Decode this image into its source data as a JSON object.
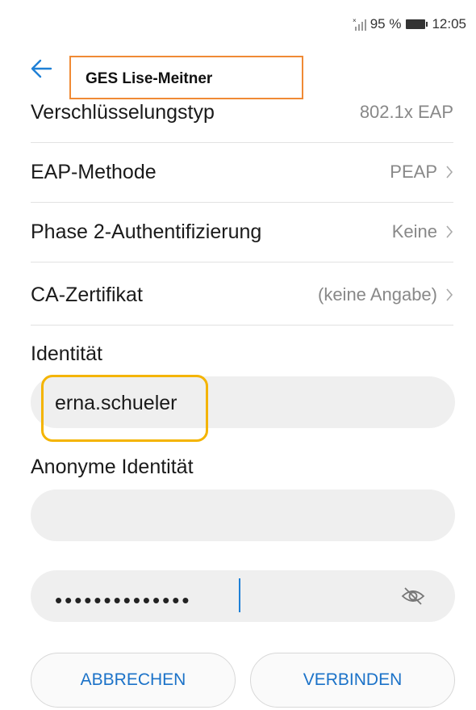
{
  "status_bar": {
    "battery": "95 %",
    "time": "12:05"
  },
  "header": {
    "title": "GES Lise-Meitner"
  },
  "settings": [
    {
      "label": "Verschlüsselungstyp",
      "value": "802.1x EAP",
      "has_chevron": false
    },
    {
      "label": "EAP-Methode",
      "value": "PEAP",
      "has_chevron": true
    },
    {
      "label": "Phase 2-Authentifizierung",
      "value": "Keine",
      "has_chevron": true
    },
    {
      "label": "CA-Zertifikat",
      "value": "(keine Angabe)",
      "has_chevron": true
    }
  ],
  "identity": {
    "label": "Identität",
    "value": "erna.schueler"
  },
  "anon_identity": {
    "label": "Anonyme Identität",
    "value": ""
  },
  "password": {
    "masked": "••••••••••••••"
  },
  "buttons": {
    "cancel": "ABBRECHEN",
    "connect": "VERBINDEN"
  },
  "colors": {
    "accent": "#1b72c8",
    "title_highlight": "#f08a35",
    "identity_highlight": "#f4b400",
    "field_bg": "#efefef"
  }
}
